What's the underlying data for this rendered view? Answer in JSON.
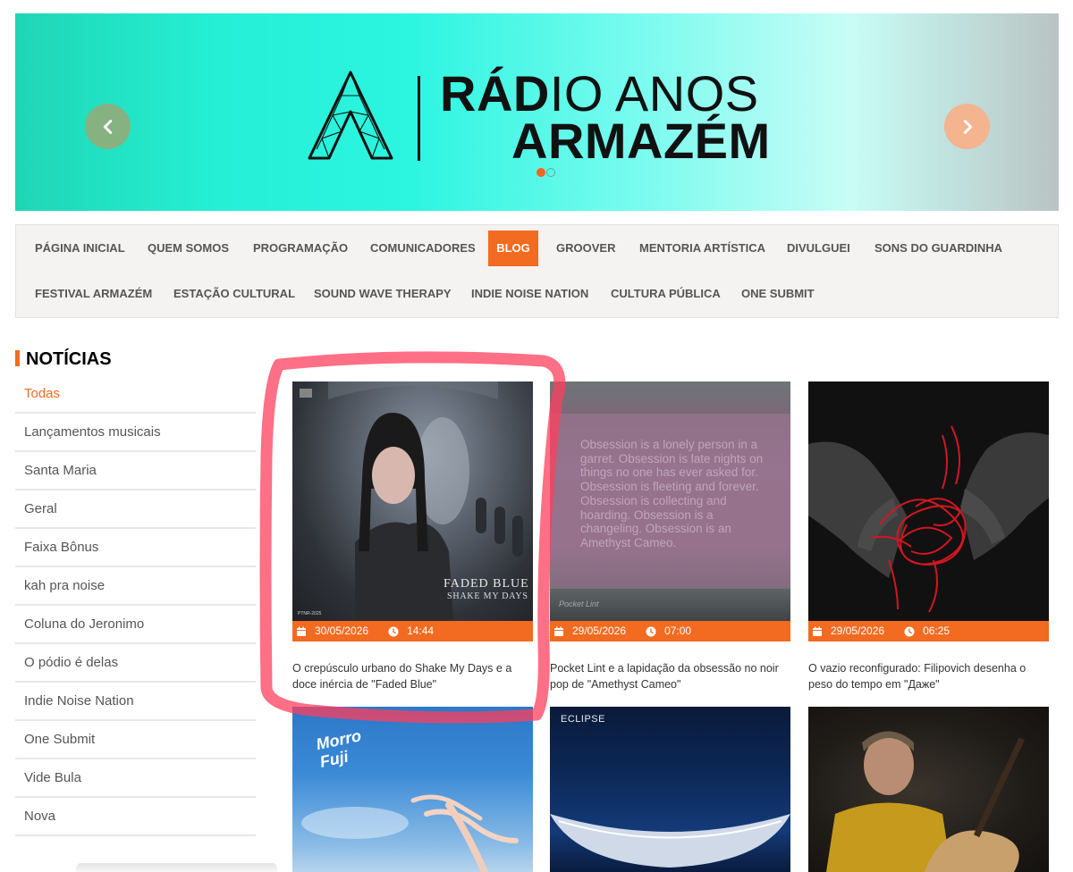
{
  "banner": {
    "logo_letter": "A",
    "title_bold_part": "RÁD",
    "title_rest": "IO ANOS",
    "title_line2": "ARMAZÉM",
    "colors": {
      "accent": "#f2641f",
      "prev_arrow": "#86b282",
      "next_arrow": "#f3b48f"
    },
    "prev_icon": "chevron-left-icon",
    "next_icon": "chevron-right-icon",
    "slides": 2,
    "active_slide": 1
  },
  "nav": {
    "items": [
      {
        "label": "PÁGINA INICIAL"
      },
      {
        "label": "QUEM SOMOS"
      },
      {
        "label": "PROGRAMAÇÃO"
      },
      {
        "label": "COMUNICADORES"
      },
      {
        "label": "BLOG",
        "active": true
      },
      {
        "label": "GROOVER"
      },
      {
        "label": "MENTORIA ARTÍSTICA"
      },
      {
        "label": "DIVULGUEI"
      },
      {
        "label": "SONS DO GUARDINHA"
      },
      {
        "label": "FESTIVAL ARMAZÉM"
      },
      {
        "label": "ESTAÇÃO CULTURAL"
      },
      {
        "label": "SOUND WAVE THERAPY"
      },
      {
        "label": "INDIE NOISE NATION"
      },
      {
        "label": "CULTURA PÚBLICA"
      },
      {
        "label": "ONE SUBMIT"
      }
    ]
  },
  "sidebar": {
    "title": "NOTÍCIAS",
    "categories": [
      {
        "label": "Todas",
        "active": true
      },
      {
        "label": "Lançamentos musicais"
      },
      {
        "label": "Santa Maria"
      },
      {
        "label": "Geral"
      },
      {
        "label": "Faixa Bônus"
      },
      {
        "label": "kah pra noise"
      },
      {
        "label": "Coluna do Jeronimo"
      },
      {
        "label": "O pódio é delas"
      },
      {
        "label": "Indie Noise Nation"
      },
      {
        "label": "One Submit"
      },
      {
        "label": "Vide Bula"
      },
      {
        "label": "Nova"
      }
    ]
  },
  "posts": [
    {
      "date": "30/05/2026",
      "time": "14:44",
      "caption": "O crepúsculo urbano do Shake My Days e a doce inércia de \"Faded Blue\"",
      "cover_title": "FADED BLUE",
      "cover_subtitle": "SHAKE MY DAYS",
      "cover_small": "PTNR-2025"
    },
    {
      "date": "29/05/2026",
      "time": "07:00",
      "caption": "Pocket Lint e a lapidação da obsessão no noir pop de \"Amethyst Cameo\"",
      "cover_text": "Obsession is a lonely person in a garret. Obsession is late nights on things no one has ever asked for. Obsession is fleeting and forever. Obsession is collecting and hoarding. Obsession is a changeling. Obsession is an Amethyst Cameo.",
      "cover_small": "Pocket Lint"
    },
    {
      "date": "29/05/2026",
      "time": "06:25",
      "caption": "O vazio reconfigurado: Filipovich desenha o peso do tempo em \"Даже\""
    },
    {
      "cover_title": "Morro Fuji"
    },
    {
      "cover_title": "ECLIPSE"
    },
    {}
  ],
  "icons": {
    "date": "calendar-icon",
    "time": "clock-icon"
  }
}
